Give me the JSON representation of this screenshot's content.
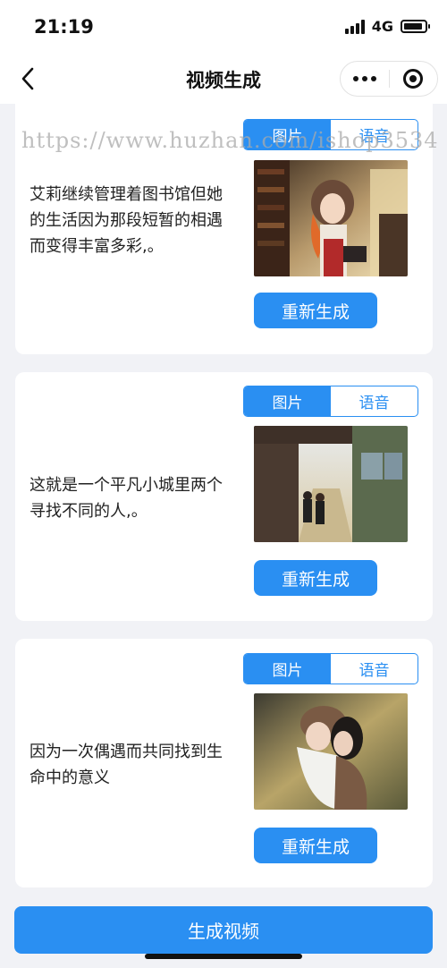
{
  "status_bar": {
    "time": "21:19",
    "network": "4G"
  },
  "nav": {
    "title": "视频生成"
  },
  "watermark": "https://www.huzhan.com/ishop3534",
  "tabs": {
    "image": "图片",
    "voice": "语音"
  },
  "cards": [
    {
      "text": "艾莉继续管理着图书馆但她的生活因为那段短暂的相遇而变得丰富多彩,。",
      "active_tab": "图片",
      "regenerate_label": "重新生成"
    },
    {
      "text": "这就是一个平凡小城里两个寻找不同的人,。",
      "active_tab": "图片",
      "regenerate_label": "重新生成"
    },
    {
      "text": "因为一次偶遇而共同找到生命中的意义",
      "active_tab": "图片",
      "regenerate_label": "重新生成"
    }
  ],
  "generate_button": "生成视频",
  "colors": {
    "accent": "#2a8ff2",
    "background": "#f1f2f6",
    "card": "#ffffff"
  }
}
